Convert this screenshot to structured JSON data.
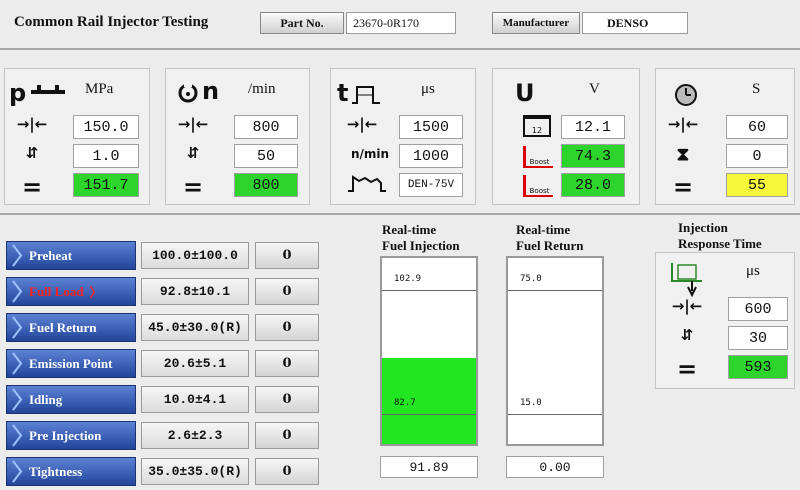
{
  "header": {
    "title": "Common Rail Injector Testing",
    "part_label": "Part No.",
    "part_value": "23670-0R170",
    "manufacturer_label": "Manufacturer",
    "manufacturer_value": "DENSO"
  },
  "pressure": {
    "symbol": "p",
    "unit": "MPa",
    "target": "150.0",
    "tolerance": "1.0",
    "actual": "151.7"
  },
  "speed": {
    "symbol": "n",
    "unit": "/min",
    "target": "800",
    "tolerance": "50",
    "actual": "800"
  },
  "pulse": {
    "symbol": "t",
    "unit": "μs",
    "width": "1500",
    "rate_label": "n/min",
    "rate": "1000",
    "wave": "DEN-75V"
  },
  "voltage": {
    "symbol": "U",
    "unit": "V",
    "battery": "12.1",
    "battery_icon_label": "12",
    "boost_icon_label": "Boost",
    "boost1": "74.3",
    "boost2": "28.0"
  },
  "timer": {
    "unit": "S",
    "target": "60",
    "tolerance": "0",
    "elapsed": "55"
  },
  "items": [
    {
      "label": "Preheat",
      "spec": "100.0±100.0",
      "count": "0"
    },
    {
      "label": "Full Load",
      "spec": "92.8±10.1",
      "count": "0",
      "active": true,
      "marker": "〉"
    },
    {
      "label": "Fuel Return",
      "spec": "45.0±30.0(R)",
      "count": "0"
    },
    {
      "label": "Emission Point",
      "spec": "20.6±5.1",
      "count": "0"
    },
    {
      "label": "Idling",
      "spec": "10.0±4.1",
      "count": "0"
    },
    {
      "label": "Pre Injection",
      "spec": "2.6±2.3",
      "count": "0"
    },
    {
      "label": "Tightness",
      "spec": "35.0±35.0(R)",
      "count": "0"
    }
  ],
  "injection_tube": {
    "title_line1": "Real-time",
    "title_line2": "Fuel Injection",
    "upper": "102.9",
    "lower": "82.7",
    "value": "91.89",
    "fill_fraction": 0.46
  },
  "return_tube": {
    "title_line1": "Real-time",
    "title_line2": "Fuel Return",
    "upper": "75.0",
    "lower": "15.0",
    "value": "0.00",
    "fill_fraction": 0
  },
  "response": {
    "title_line1": "Injection",
    "title_line2": "Response Time",
    "unit": "μs",
    "target": "600",
    "tolerance": "30",
    "actual": "593"
  },
  "colors": {
    "ok_green": "#2cd42c",
    "warn_yellow": "#f6f63a",
    "item_blue": "#22459a",
    "active_red": "#ff2020"
  }
}
